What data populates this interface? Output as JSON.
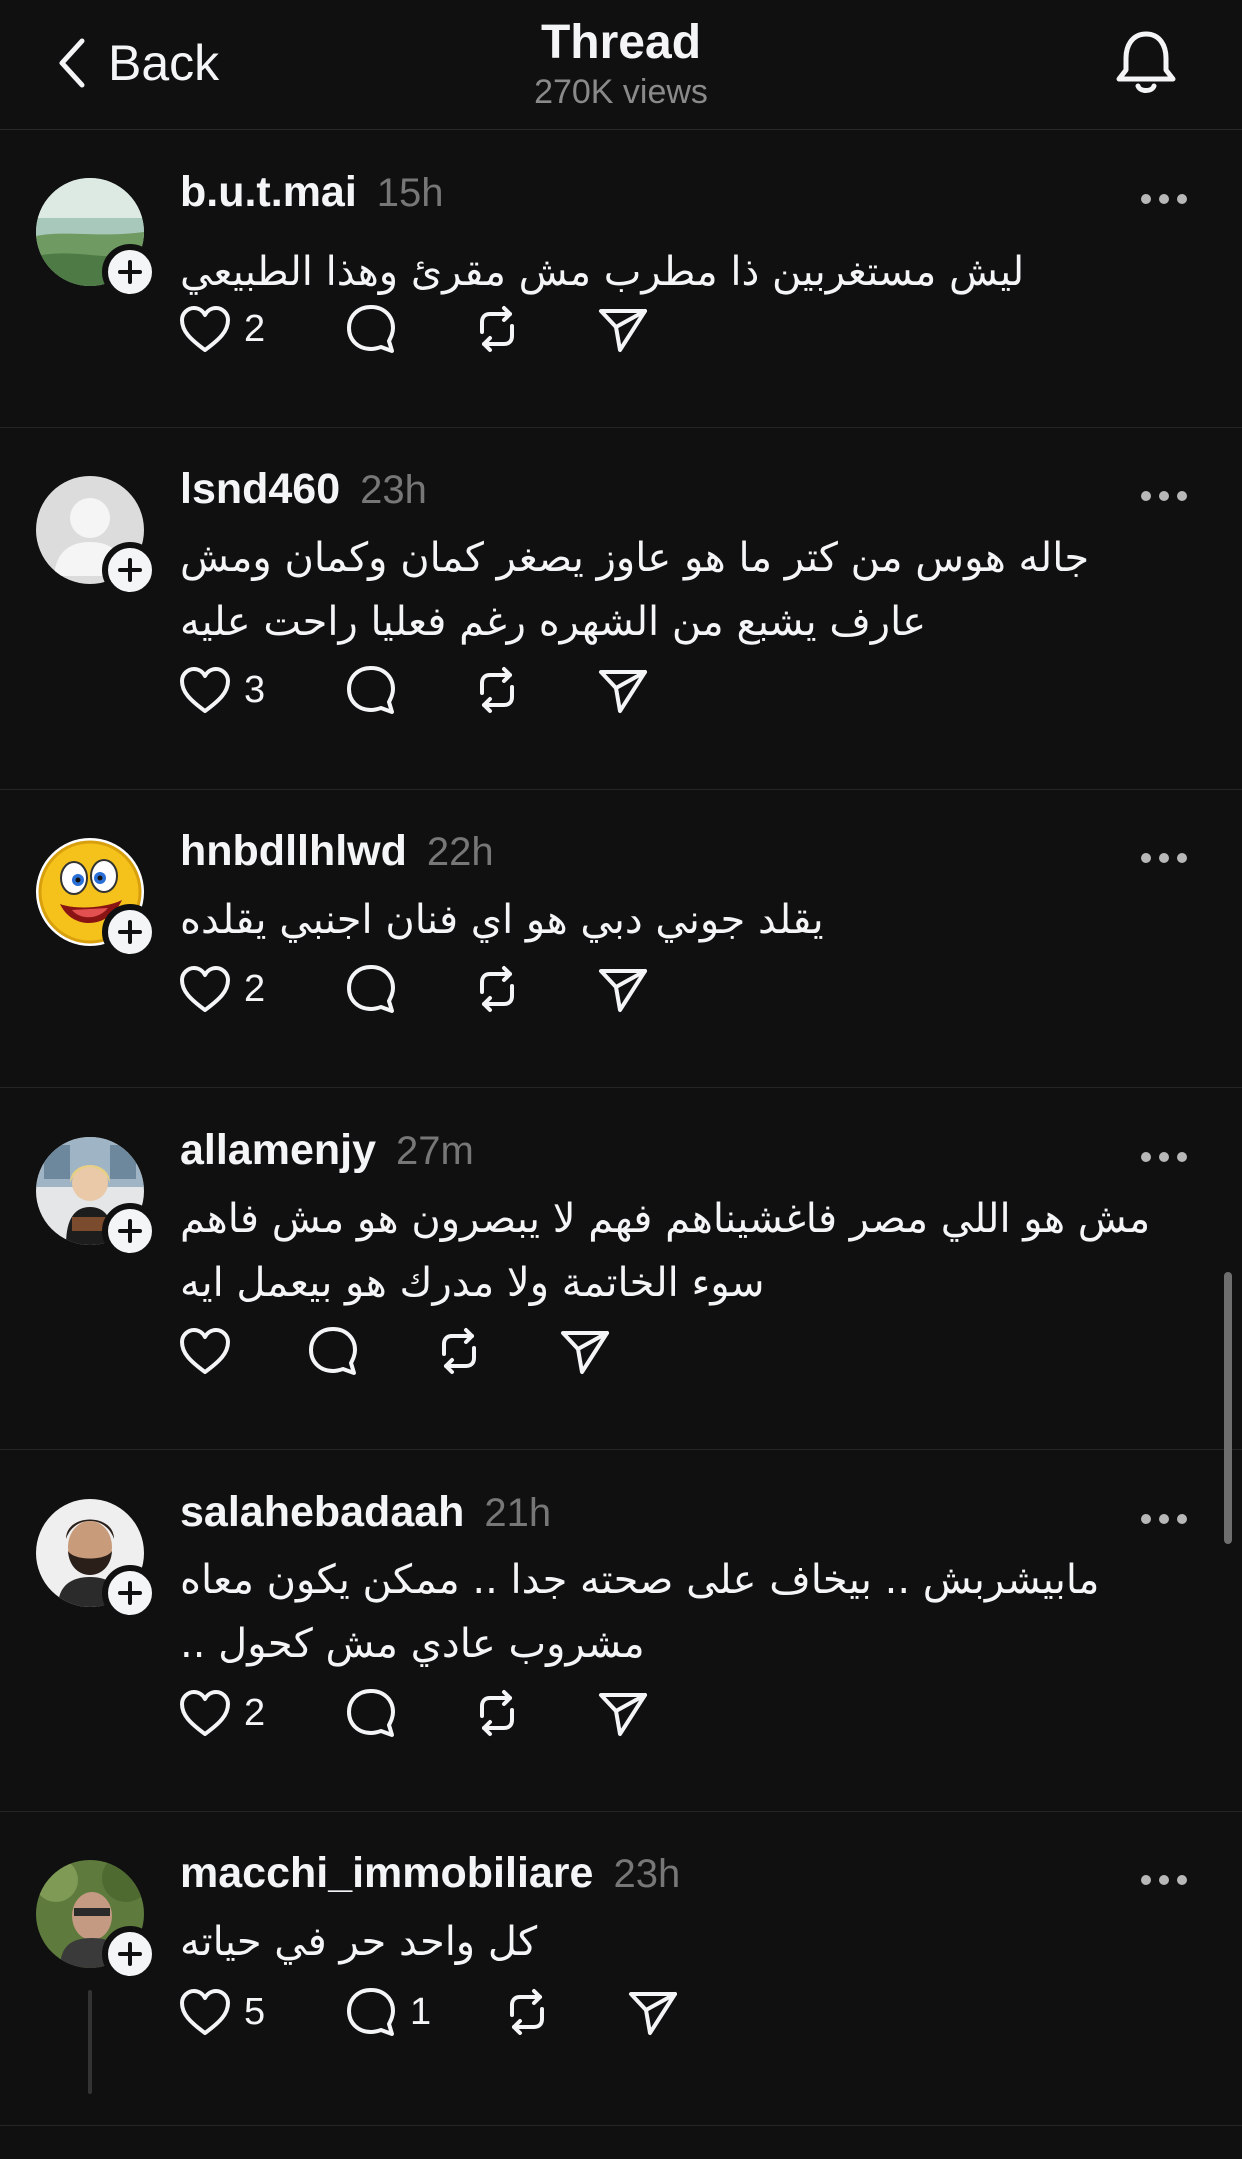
{
  "header": {
    "back_label": "Back",
    "title": "Thread",
    "subtitle": "270K views"
  },
  "posts": [
    {
      "username": "b.u.t.mai",
      "time": "15h",
      "lines": [
        "ليش مستغربين ذا مطرب مش مقرئ  وهذا الطبيعي"
      ],
      "likes": "2",
      "replies": "",
      "avatar": "landscape"
    },
    {
      "username": "lsnd460",
      "time": "23h",
      "lines": [
        "جاله هوس من كتر ما هو عاوز يصغر كمان وكمان ومش",
        "عارف يشبع من الشهره رغم فعليا راحت عليه"
      ],
      "likes": "3",
      "replies": "",
      "avatar": "default"
    },
    {
      "username": "hnbdllhlwd",
      "time": "22h",
      "lines": [
        "يقلد جوني دبي هو اي فنان اجنبي يقلده"
      ],
      "likes": "2",
      "replies": "",
      "avatar": "emoji"
    },
    {
      "username": "allamenjy",
      "time": "27m",
      "lines": [
        "مش هو اللي مصر فاغشيناهم فهم لا يبصرون هو مش فاهم",
        "سوء الخاتمة ولا مدرك هو بيعمل ايه"
      ],
      "likes": "",
      "replies": "",
      "avatar": "office"
    },
    {
      "username": "salahebadaah",
      "time": "21h",
      "lines": [
        "مابيشربش .. بيخاف على صحته جدا .. ممكن يكون معاه",
        "مشروب عادي مش كحول .."
      ],
      "likes": "2",
      "replies": "",
      "avatar": "bearded"
    },
    {
      "username": "macchi_immobiliare",
      "time": "23h",
      "lines": [
        "كل واحد حر في حياته"
      ],
      "likes": "5",
      "replies": "1",
      "avatar": "outdoor"
    }
  ],
  "icons": {
    "back": "chevron-left-icon",
    "bell": "bell-icon",
    "more": "more-icon",
    "like": "heart-icon",
    "reply": "comment-icon",
    "repost": "repost-icon",
    "share": "send-icon",
    "follow": "plus-icon"
  },
  "colors": {
    "background": "#101010",
    "text": "#f3f5f7",
    "secondary": "#777777",
    "divider": "#262626"
  }
}
